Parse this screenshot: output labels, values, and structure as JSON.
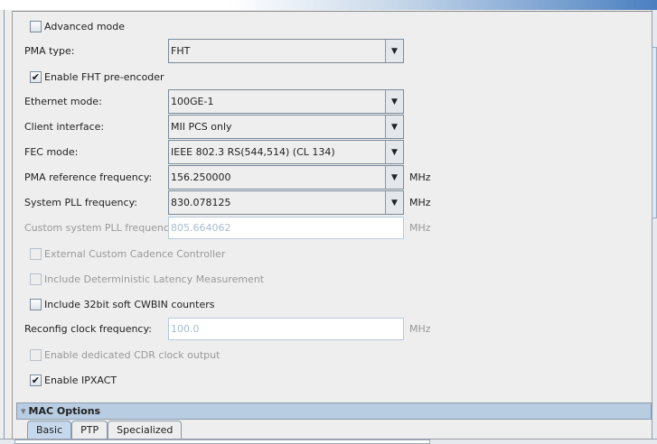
{
  "advanced_mode": {
    "label": "Advanced mode",
    "checked": false
  },
  "pma_type": {
    "label": "PMA type:",
    "value": "FHT"
  },
  "enable_fht": {
    "label": "Enable FHT pre-encoder",
    "checked": true
  },
  "ethernet_mode": {
    "label": "Ethernet mode:",
    "value": "100GE-1"
  },
  "client_interface": {
    "label": "Client interface:",
    "value": "MII PCS only"
  },
  "fec_mode": {
    "label": "FEC mode:",
    "value": "IEEE 802.3 RS(544,514) (CL 134)"
  },
  "pma_ref": {
    "label": "PMA reference frequency:",
    "value": "156.250000",
    "unit": "MHz"
  },
  "sys_pll": {
    "label": "System PLL frequency:",
    "value": "830.078125",
    "unit": "MHz"
  },
  "custom_pll": {
    "label": "Custom system PLL frequency:",
    "value": "805.664062",
    "unit": "MHz"
  },
  "ext_cadence": {
    "label": "External Custom Cadence Controller",
    "checked": false
  },
  "det_latency": {
    "label": "Include Deterministic Latency Measurement",
    "checked": false
  },
  "cwbin": {
    "label": "Include 32bit soft CWBIN counters",
    "checked": false
  },
  "reconfig_clock": {
    "label": "Reconfig clock frequency:",
    "value": "100.0",
    "unit": "MHz"
  },
  "cdr_clock": {
    "label": "Enable dedicated CDR clock output",
    "checked": false
  },
  "ipxact": {
    "label": "Enable IPXACT",
    "checked": true
  },
  "mac_options": {
    "title": "MAC Options",
    "tabs": [
      "Basic",
      "PTP",
      "Specialized"
    ]
  },
  "glyphs": {
    "check": "✔",
    "arrow": "▼",
    "collapse": "▾"
  }
}
